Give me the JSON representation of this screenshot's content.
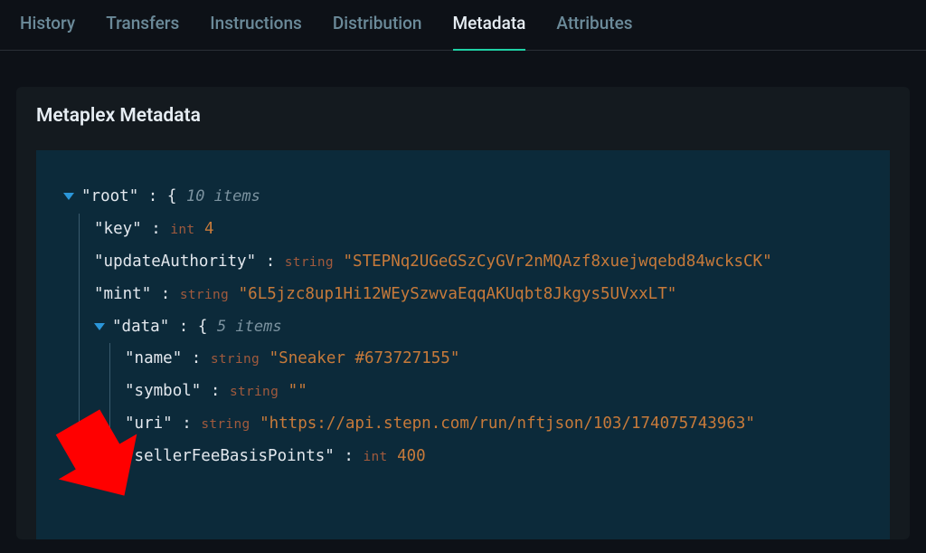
{
  "tabs": [
    {
      "label": "History"
    },
    {
      "label": "Transfers"
    },
    {
      "label": "Instructions"
    },
    {
      "label": "Distribution"
    },
    {
      "label": "Metadata",
      "active": true
    },
    {
      "label": "Attributes"
    }
  ],
  "panel": {
    "title": "Metaplex Metadata"
  },
  "json": {
    "root_key": "root",
    "root_items": "10 items",
    "key_label": "key",
    "key_type": "int",
    "key_value": "4",
    "updateAuthority_label": "updateAuthority",
    "updateAuthority_type": "string",
    "updateAuthority_value": "STEPNq2UGeGSzCyGVr2nMQAzf8xuejwqebd84wcksCK",
    "mint_label": "mint",
    "mint_type": "string",
    "mint_value": "6L5jzc8up1Hi12WEySzwvaEqqAKUqbt8Jkgys5UVxxLT",
    "data_key": "data",
    "data_items": "5 items",
    "name_label": "name",
    "name_type": "string",
    "name_value": "Sneaker #673727155",
    "symbol_label": "symbol",
    "symbol_type": "string",
    "symbol_value": "",
    "uri_label": "uri",
    "uri_type": "string",
    "uri_value": "https://api.stepn.com/run/nftjson/103/174075743963",
    "sfbp_label": "sellerFeeBasisPoints",
    "sfbp_type": "int",
    "sfbp_value": "400"
  }
}
